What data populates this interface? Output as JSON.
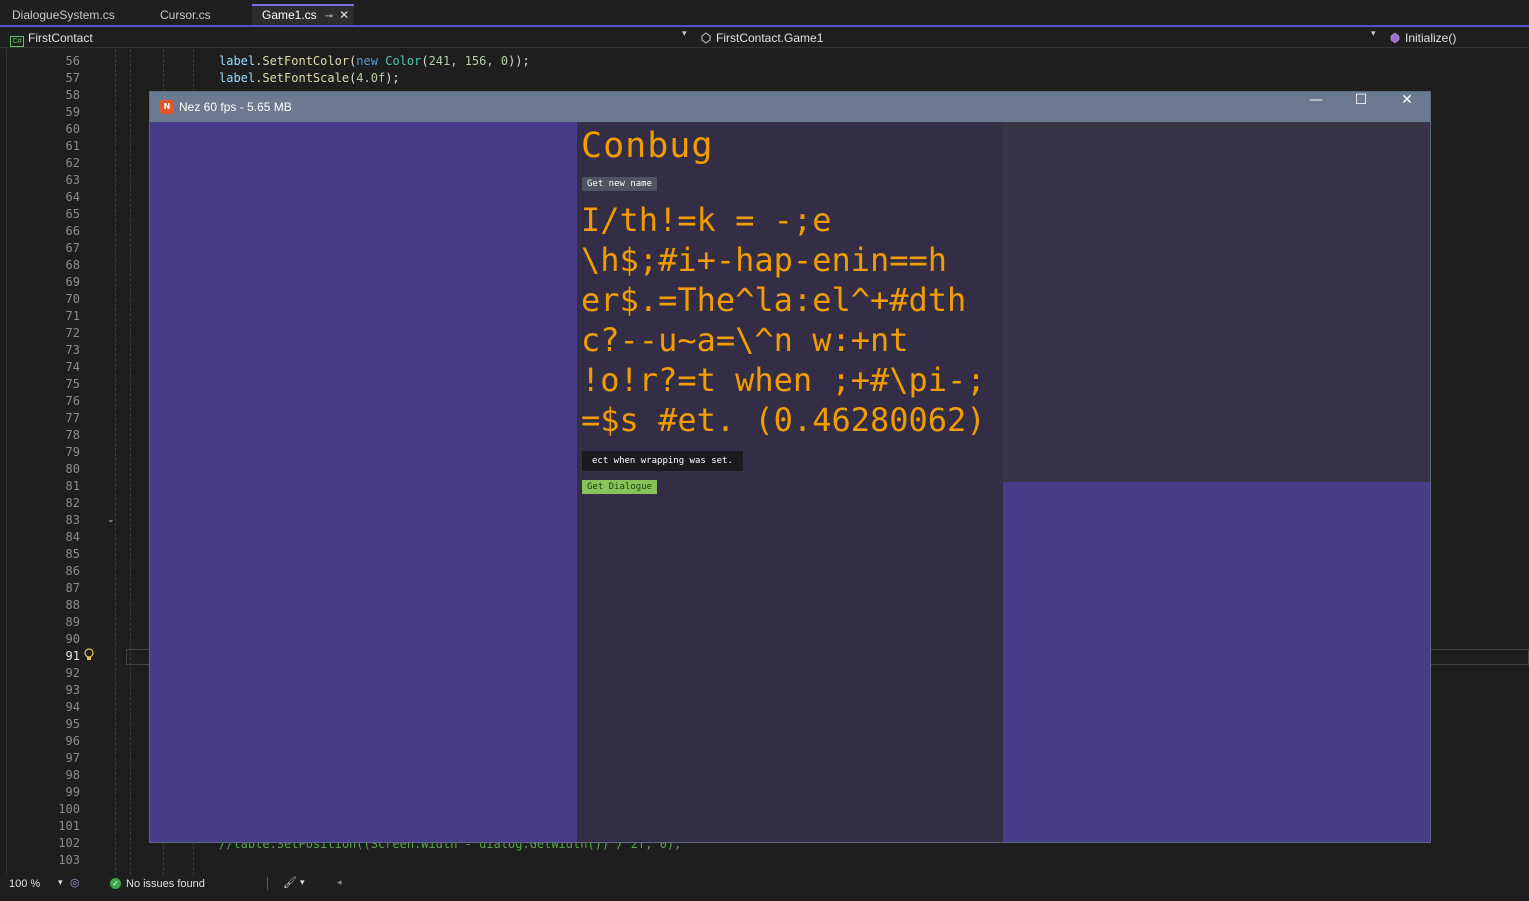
{
  "tabs": [
    {
      "label": "DialogueSystem.cs",
      "active": false
    },
    {
      "label": "Cursor.cs",
      "active": false
    },
    {
      "label": "Game1.cs",
      "active": true
    }
  ],
  "nav": {
    "project": "FirstContact",
    "class": "FirstContact.Game1",
    "member": "Initialize()"
  },
  "editor": {
    "line_numbers": [
      "56",
      "57",
      "58",
      "59",
      "60",
      "61",
      "62",
      "63",
      "64",
      "65",
      "66",
      "67",
      "68",
      "69",
      "70",
      "71",
      "72",
      "73",
      "74",
      "75",
      "76",
      "77",
      "78",
      "79",
      "80",
      "81",
      "82",
      "83",
      "84",
      "85",
      "86",
      "87",
      "88",
      "89",
      "90",
      "91",
      "92",
      "93",
      "94",
      "95",
      "96",
      "97",
      "98",
      "99",
      "100",
      "101",
      "102",
      "103"
    ],
    "current_line": "91",
    "visible_code": {
      "line56": {
        "obj": "label",
        "method": "SetFontColor",
        "kw": "new",
        "type": "Color",
        "args": "241, 156, 0"
      },
      "line57": {
        "obj": "label",
        "method": "SetFontScale",
        "arg": "4.0f"
      },
      "line102": "//table.SetPosition((Screen.Width - dialog.GetWidth()) / 2f, 0);"
    }
  },
  "status": {
    "zoom": "100 %",
    "issues": "No issues found"
  },
  "game_window": {
    "title": "Nez 60 fps - 5.65 MB",
    "logo_text": "N",
    "controls": {
      "minimize": "—",
      "maximize": "☐",
      "close": "✕"
    },
    "heading": "Conbug",
    "new_name_button": "Get new name",
    "garbled_text": "I/th!=k = -;e\n\\h$;#i+-hap-enin==h\ner$.=The^la:el^+#dth\nc?--u~a=\\^n w:+nt\n!o!r?=t when ;+#\\pi-;\n=$s #et. (0.46280062)",
    "tooltip": "ect when wrapping was set.",
    "dialogue_button": "Get Dialogue"
  },
  "colors": {
    "accent": "#5a4fcf",
    "game_bg": "#473c8a",
    "panel": "#332e46",
    "text_orange": "#f19c00",
    "button_green": "#8ac25a"
  },
  "icons": [
    "csharp-project-icon",
    "class-icon",
    "method-icon",
    "pin-icon",
    "close-icon",
    "chevron-down-icon",
    "lightbulb-icon",
    "check-circle-icon",
    "copilot-icon",
    "brush-icon",
    "nez-logo-icon",
    "minimize-icon",
    "maximize-icon"
  ]
}
